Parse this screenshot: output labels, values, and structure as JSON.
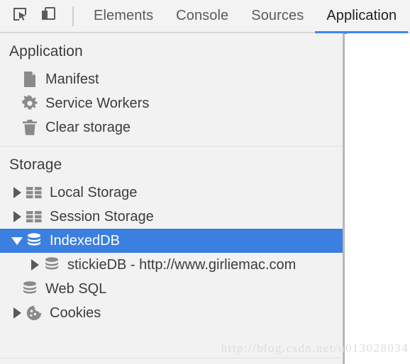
{
  "toolbar": {
    "buttons": [
      {
        "name": "inspect-element-icon",
        "title": "Inspect element"
      },
      {
        "name": "device-toolbar-icon",
        "title": "Toggle device toolbar"
      }
    ],
    "tabs": [
      {
        "label": "Elements",
        "active": false
      },
      {
        "label": "Console",
        "active": false
      },
      {
        "label": "Sources",
        "active": false
      },
      {
        "label": "Application",
        "active": true
      }
    ]
  },
  "sidebar": {
    "sections": [
      {
        "title": "Application",
        "items": [
          {
            "label": "Manifest",
            "icon": "document-icon"
          },
          {
            "label": "Service Workers",
            "icon": "gear-icon"
          },
          {
            "label": "Clear storage",
            "icon": "trash-icon"
          }
        ]
      },
      {
        "title": "Storage",
        "items": [
          {
            "label": "Local Storage",
            "icon": "table-icon",
            "twisty": "collapsed"
          },
          {
            "label": "Session Storage",
            "icon": "table-icon",
            "twisty": "collapsed"
          },
          {
            "label": "IndexedDB",
            "icon": "database-icon",
            "twisty": "expanded",
            "selected": true
          },
          {
            "label": "stickieDB - http://www.girliemac.com",
            "icon": "database-icon",
            "twisty": "collapsed",
            "child": true
          },
          {
            "label": "Web SQL",
            "icon": "database-icon",
            "twisty": "none"
          },
          {
            "label": "Cookies",
            "icon": "cookie-icon",
            "twisty": "collapsed"
          }
        ]
      }
    ]
  },
  "watermark": {
    "text": "http://blog.csdn.net/u013028034"
  },
  "colors": {
    "accent": "#4285f4",
    "selection": "#3b7fe0",
    "sidebar_bg": "#f2f2f2",
    "toolbar_bg": "#f3f3f3",
    "icon_gray": "#8a8a8a",
    "text": "#3c3c3c"
  }
}
